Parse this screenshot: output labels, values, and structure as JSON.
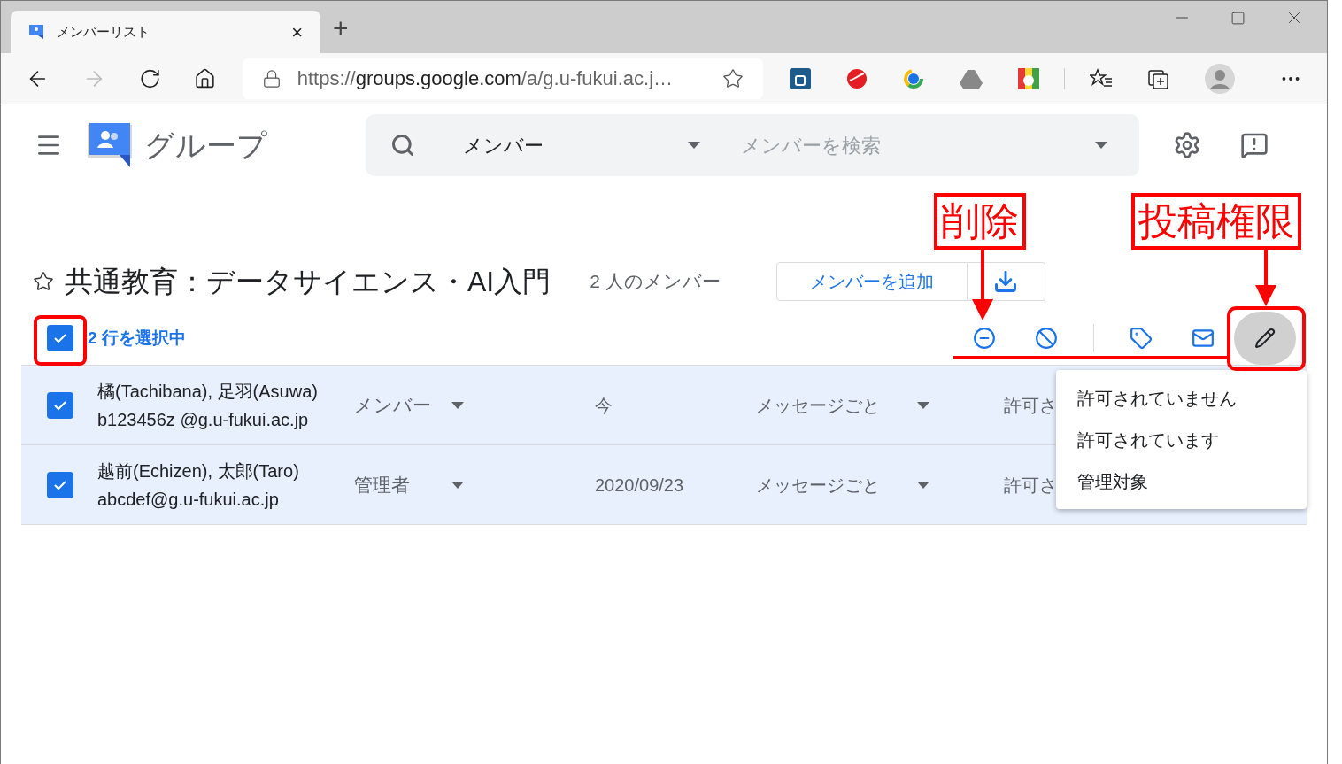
{
  "browser": {
    "tab": {
      "title": "メンバーリスト",
      "close": "×"
    },
    "new_tab": "+",
    "address": {
      "host": "https://groups.google.com",
      "path": "/a/g.u-fukui.ac.j…"
    }
  },
  "app": {
    "name": "グループ",
    "search": {
      "scope": "メンバー",
      "placeholder": "メンバーを検索"
    }
  },
  "group": {
    "starred": false,
    "title": "共通教育：データサイエンス・AI入門",
    "member_count": "2 人のメンバー",
    "add_button": "メンバーを追加"
  },
  "selection": {
    "checked": true,
    "label": "2 行を選択中",
    "posting_button_active": true
  },
  "members": [
    {
      "selected": true,
      "name": "橘(Tachibana), 足羽(Asuwa)",
      "email": "b123456z @g.u-fukui.ac.jp",
      "role": "メンバー",
      "joined": "今",
      "delivery": "メッセージごと",
      "posting": "許可さ"
    },
    {
      "selected": true,
      "name": "越前(Echizen), 太郎(Taro)",
      "email": "abcdef@g.u-fukui.ac.jp",
      "role": "管理者",
      "joined": "2020/09/23",
      "delivery": "メッセージごと",
      "posting": "許可さ"
    }
  ],
  "posting_menu": {
    "items": [
      "許可されていません",
      "許可されています",
      "管理対象"
    ]
  },
  "annotations": [
    {
      "label": "削除"
    },
    {
      "label": "投稿権限"
    }
  ]
}
